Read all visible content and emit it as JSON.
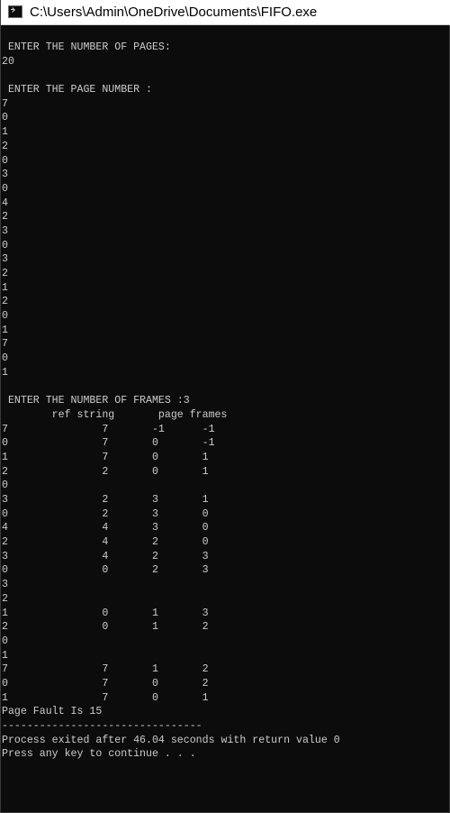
{
  "window": {
    "title": "C:\\Users\\Admin\\OneDrive\\Documents\\FIFO.exe",
    "icon": "console-app-icon"
  },
  "console": {
    "lines": [
      " ENTER THE NUMBER OF PAGES:",
      "20",
      "",
      " ENTER THE PAGE NUMBER :",
      "7",
      "0",
      "1",
      "2",
      "0",
      "3",
      "0",
      "4",
      "2",
      "3",
      "0",
      "3",
      "2",
      "1",
      "2",
      "0",
      "1",
      "7",
      "0",
      "1",
      "",
      " ENTER THE NUMBER OF FRAMES :3",
      "        ref string       page frames",
      "7               7       -1      -1",
      "0               7       0       -1",
      "1               7       0       1",
      "2               2       0       1",
      "0",
      "3               2       3       1",
      "0               2       3       0",
      "4               4       3       0",
      "2               4       2       0",
      "3               4       2       3",
      "0               0       2       3",
      "3",
      "2",
      "1               0       1       3",
      "2               0       1       2",
      "0",
      "1",
      "7               7       1       2",
      "0               7       0       2",
      "1               7       0       1",
      "Page Fault Is 15",
      "--------------------------------",
      "Process exited after 46.04 seconds with return value 0",
      "Press any key to continue . . ."
    ]
  }
}
